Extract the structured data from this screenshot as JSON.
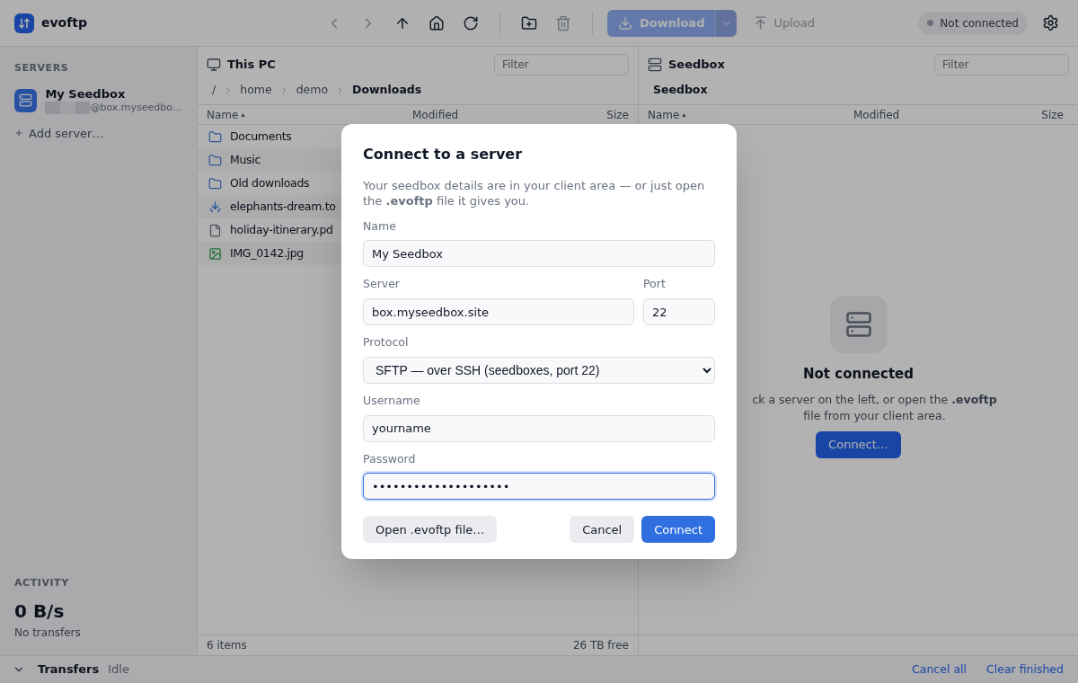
{
  "app": {
    "title": "evoftp"
  },
  "toolbar": [
    {
      "kind": "back",
      "disabled": true
    },
    {
      "kind": "forward",
      "disabled": true
    },
    {
      "kind": "up",
      "disabled": false
    },
    {
      "kind": "home",
      "disabled": false
    },
    {
      "kind": "refresh",
      "disabled": false
    },
    {
      "kind": "divider"
    },
    {
      "kind": "new-folder",
      "disabled": false
    },
    {
      "kind": "delete",
      "disabled": true
    },
    {
      "kind": "divider"
    }
  ],
  "download_button": {
    "label": "Download",
    "disabled": true
  },
  "upload_button": {
    "label": "Upload",
    "disabled": true
  },
  "status_pill": {
    "label": "Not connected",
    "connected": false
  },
  "sidebar": {
    "servers_heading": "SERVERS",
    "servers": [
      {
        "name": "My Seedbox",
        "address": "@box.myseedbo…",
        "selected": false
      }
    ],
    "add_server": "Add server…",
    "activity_heading": "ACTIVITY",
    "speed": "0 B/s",
    "transfers": "No transfers"
  },
  "local_pane": {
    "title": "This PC",
    "filter_placeholder": "Filter",
    "breadcrumbs": [
      {
        "label": "/",
        "current": false
      },
      {
        "label": "home",
        "current": false
      },
      {
        "label": "demo",
        "current": false
      },
      {
        "label": "Downloads",
        "current": true
      }
    ],
    "columns": [
      "Name",
      "Modified",
      "Size"
    ],
    "sort_mark": "▴",
    "rows": [
      {
        "kind": "folder",
        "name": "Documents"
      },
      {
        "kind": "folder",
        "name": "Music"
      },
      {
        "kind": "folder",
        "name": "Old downloads"
      },
      {
        "kind": "torrent",
        "name": "elephants-dream.to"
      },
      {
        "kind": "file",
        "name": "holiday-itinerary.pd"
      },
      {
        "kind": "image",
        "name": "IMG_0142.jpg"
      }
    ],
    "footer_left": "6 items",
    "footer_right": "26 TB free"
  },
  "remote_pane": {
    "title": "Seedbox",
    "filter_placeholder": "Filter",
    "breadcrumb": "Seedbox",
    "columns": [
      "Name",
      "Modified",
      "Size"
    ],
    "sort_mark": "▴",
    "empty_title": "Not connected",
    "empty_text": "ck a server on the left, or open the **.evoftp** file from your client area.",
    "connect_button": "Connect…"
  },
  "bottom_bar": {
    "label": "Transfers",
    "status": "Idle",
    "expanded": false,
    "actions": [
      "Cancel all",
      "Clear finished"
    ]
  },
  "dialog": {
    "title": "Connect to a server",
    "intro": "Your seedbox details are in your client area — or just open the **.evoftp** file it gives you.",
    "fields": [
      {
        "kind": "text",
        "label": "Name",
        "value": "My Seedbox",
        "focused": false
      },
      {
        "kind": "pair",
        "label": "Server",
        "value": "box.myseedbox.site",
        "focused": false,
        "label2": "Port",
        "value2": "22"
      },
      {
        "kind": "select",
        "label": "Protocol",
        "value": "SFTP — over SSH (seedboxes, port 22)",
        "focused": false
      },
      {
        "kind": "text",
        "label": "Username",
        "value": "yourname",
        "focused": false
      },
      {
        "kind": "text",
        "label": "Password",
        "value": "••••••••••••••••••••",
        "focused": true
      }
    ],
    "open_file_button": "Open .evoftp file…",
    "cancel_button": "Cancel",
    "connect_button": "Connect"
  }
}
